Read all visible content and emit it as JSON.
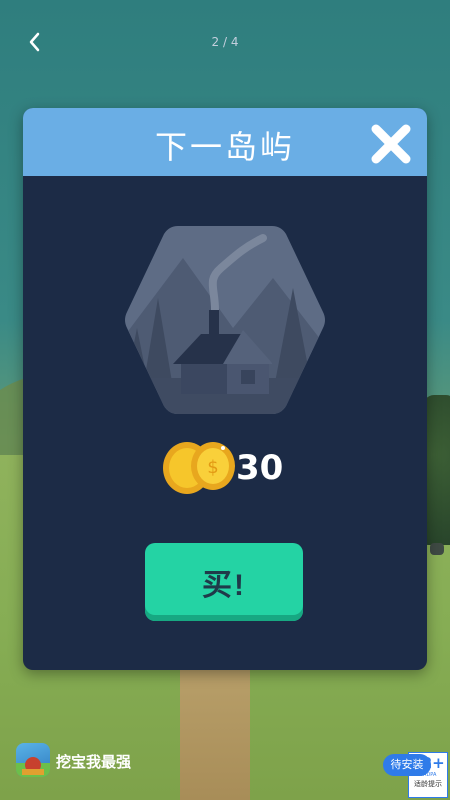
{
  "topbar": {
    "pager": "2 / 4"
  },
  "modal": {
    "title": "下一岛屿",
    "price": "30",
    "buy_label": "买!"
  },
  "footer": {
    "app_name": "挖宝我最强",
    "install_label": "待安装",
    "age_rating": "12+",
    "age_org": "CADPA",
    "age_tip": "适龄提示"
  },
  "colors": {
    "modal_bg": "#1c2b46",
    "header_bg": "#6aaee5",
    "buy_bg": "#24d3a4",
    "install_bg": "#2f7be9"
  },
  "icons": [
    "back-chevron-icon",
    "close-icon",
    "locked-island-house-icon",
    "gold-coin-stack-icon",
    "app-icon"
  ]
}
